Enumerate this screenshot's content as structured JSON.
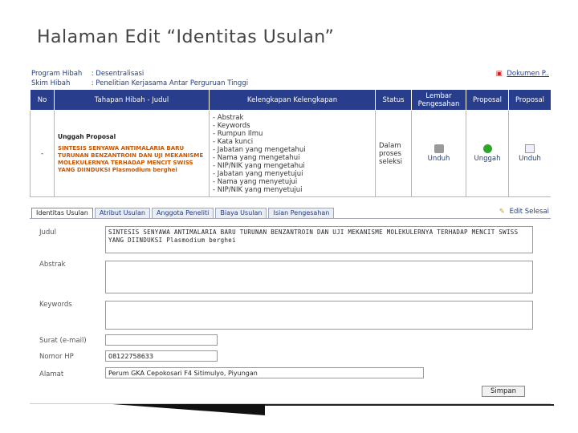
{
  "slide": {
    "title": "Halaman Edit “Identitas Usulan”"
  },
  "program": {
    "program_label": "Program Hibah",
    "program_value": ": Desentralisasi",
    "skim_label": "Skim Hibah",
    "skim_value": ": Penelitian Kerjasama Antar Perguruan Tinggi"
  },
  "doc_link": {
    "icon": "pdf-icon",
    "label": "Dokumen P.."
  },
  "table": {
    "headers": [
      "No",
      "Tahapan Hibah - Judul",
      "Kelengkapan Kelengkapan",
      "Status",
      "Lembar Pengesahan",
      "Proposal",
      "Proposal"
    ],
    "row": {
      "no": "-",
      "title": "Unggah Proposal",
      "desc": "SINTESIS SENYAWA ANTIMALARIA BARU TURUNAN BENZANTROIN DAN UJI MEKANISME MOLEKULERNYA TERHADAP MENCIT SWISS YANG DIINDUKSI Plasmodium berghei",
      "checklist": [
        "Abstrak",
        "Keywords",
        "Rumpun Ilmu",
        "Kata kunci",
        "Jabatan yang mengetahui",
        "Nama yang mengetahui",
        "NIP/NIK yang mengetahui",
        "Jabatan yang menyetujui",
        "Nama yang menyetujui",
        "NIP/NIK yang menyetujui"
      ],
      "status": "Dalam proses seleksi",
      "action_print": "Unduh",
      "action_upload": "Unggah",
      "action_download": "Unduh"
    }
  },
  "tabs": [
    "Identitas Usulan",
    "Atribut Usulan",
    "Anggota Peneliti",
    "Biaya Usulan",
    "Isian Pengesahan"
  ],
  "edit_selesai": "Edit Selesai",
  "form": {
    "judul_label": "Judul",
    "judul_value": "SINTESIS SENYAWA ANTIMALARIA BARU TURUNAN BENZANTROIN DAN UJI MEKANISME MOLEKULERNYA TERHADAP MENCIT SWISS YANG DIINDUKSI Plasmodium berghei",
    "abstrak_label": "Abstrak",
    "keywords_label": "Keywords",
    "email_label": "Surat (e-mail)",
    "email_value": "",
    "hp_label": "Nomor HP",
    "hp_value": "08122758633",
    "alamat_label": "Alamat",
    "alamat_value": "Perum GKA Cepokosari F4 Sitimulyo, Piyungan",
    "submit_label": "Simpan"
  }
}
